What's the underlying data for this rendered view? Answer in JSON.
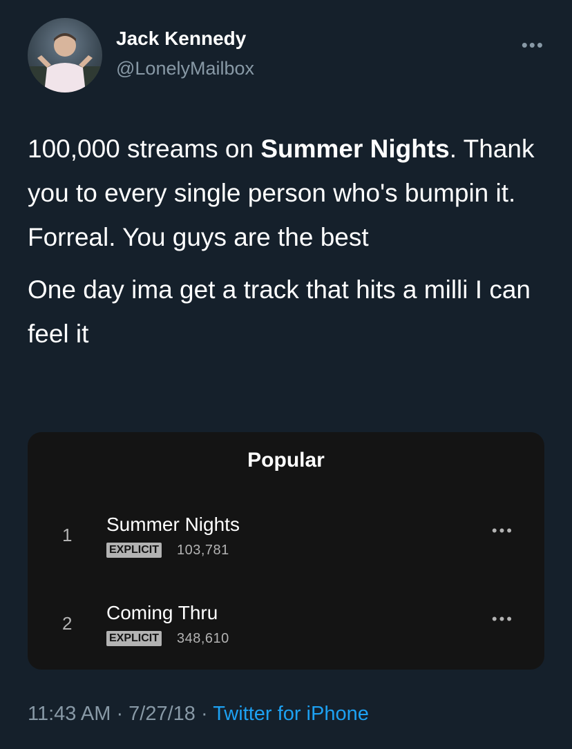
{
  "author": {
    "name": "Jack Kennedy",
    "handle": "@LonelyMailbox",
    "avatar_icon": "profile-photo"
  },
  "more_icon": "•••",
  "tweet": {
    "text_before": "100,000 streams on ",
    "text_bold": "Summer Nights",
    "text_after": ". Thank you to every single person who's bumpin it. Forreal. You guys are the best",
    "text_second": "One day ima get a track that hits a milli I can feel it"
  },
  "card": {
    "title": "Popular",
    "tracks": [
      {
        "number": "1",
        "title": "Summer Nights",
        "badge": "EXPLICIT",
        "plays": "103,781"
      },
      {
        "number": "2",
        "title": "Coming Thru",
        "badge": "EXPLICIT",
        "plays": "348,610"
      }
    ]
  },
  "footer": {
    "time": "11:43 AM",
    "sep1": " · ",
    "date": "7/27/18",
    "sep2": " · ",
    "source": "Twitter for iPhone"
  },
  "colors": {
    "background": "#15202b",
    "secondary_text": "#8899a6",
    "link": "#1da1f2",
    "card_bg": "#141414"
  }
}
